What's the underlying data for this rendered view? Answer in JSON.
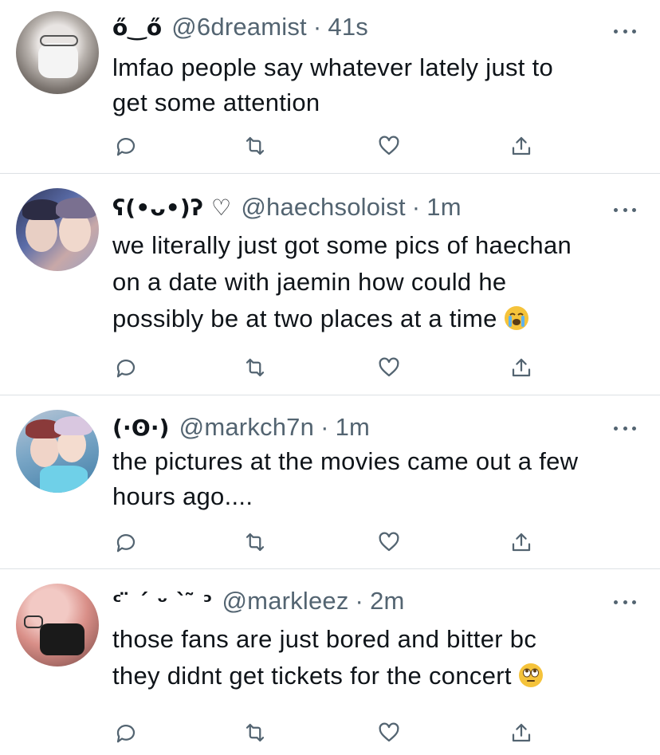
{
  "tweets": [
    {
      "display_name": "ő‿ő",
      "handle": "@6dreamist",
      "separator": "·",
      "time": "41s",
      "text_lines": [
        "lmfao people say whatever lately just to",
        "get some attention"
      ],
      "emoji": null
    },
    {
      "display_name": "ʕ(•ᴗ•)ʔ ♡",
      "handle": "@haechsoloist",
      "separator": "·",
      "time": "1m",
      "text_lines": [
        "we literally just got some pics of haechan",
        "on a date with jaemin how could he",
        "possibly be at two places at a time"
      ],
      "emoji": "loudly-crying-face"
    },
    {
      "display_name": "(·ʘ·)",
      "handle": "@markch7n",
      "separator": "·",
      "time": "1m",
      "text_lines": [
        "the pictures at the movies came out a few",
        "hours ago...."
      ],
      "emoji": null
    },
    {
      "display_name": "ᶜ ̈ ´ ᵕ ` ̃ ᵓ",
      "handle": "@markleez",
      "separator": "·",
      "time": "2m",
      "text_lines": [
        "those fans are just bored and bitter bc",
        "they didnt get tickets for the concert"
      ],
      "emoji": "face-with-rolling-eyes"
    }
  ],
  "icons": {
    "reply": "reply-icon",
    "retweet": "retweet-icon",
    "like": "like-icon",
    "share": "share-icon",
    "more": "more-icon"
  },
  "colors": {
    "text": "#0f1419",
    "secondary": "#536471",
    "divider": "#dde1e4"
  }
}
